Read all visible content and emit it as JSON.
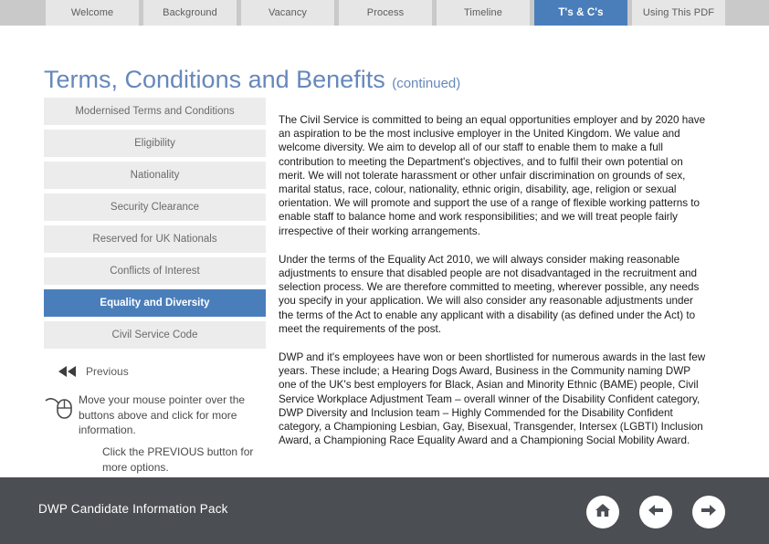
{
  "tabs": [
    {
      "label": "Welcome",
      "active": false
    },
    {
      "label": "Background",
      "active": false
    },
    {
      "label": "Vacancy",
      "active": false
    },
    {
      "label": "Process",
      "active": false
    },
    {
      "label": "Timeline",
      "active": false
    },
    {
      "label": "T's & C's",
      "active": true
    },
    {
      "label": "Using This PDF",
      "active": false
    }
  ],
  "title": {
    "main": "Terms, Conditions and Benefits ",
    "suffix": "(continued)"
  },
  "sidebar": {
    "items": [
      {
        "label": "Modernised Terms and Conditions",
        "active": false
      },
      {
        "label": "Eligibility",
        "active": false
      },
      {
        "label": "Nationality",
        "active": false
      },
      {
        "label": "Security Clearance",
        "active": false
      },
      {
        "label": "Reserved for UK Nationals",
        "active": false
      },
      {
        "label": "Conflicts of Interest",
        "active": false
      },
      {
        "label": "Equality and Diversity",
        "active": true
      },
      {
        "label": "Civil Service Code",
        "active": false
      }
    ]
  },
  "previous": {
    "label": "Previous",
    "icon": "double-chevron-left-icon"
  },
  "hints": {
    "mouse_icon": "computer-mouse-icon",
    "mouse_text": "Move your mouse pointer over the buttons above and click for more information.",
    "note_text": "Click the PREVIOUS button for more options."
  },
  "content": {
    "paragraphs": [
      "The Civil Service is committed to being an equal opportunities employer and by 2020 have an aspiration to be the most inclusive employer in the United Kingdom. We value and welcome diversity. We aim to develop all of our staff to enable them to make a full contribution to meeting the Department's objectives, and to fulfil their own potential on merit. We will not tolerate harassment or other unfair discrimination on grounds of sex, marital status, race, colour, nationality, ethnic origin, disability, age, religion or sexual orientation. We will promote and support the use of a range of flexible working patterns to enable staff to balance home and work responsibilities; and we will treat people fairly irrespective of their working arrangements.",
      "Under the terms of the Equality Act 2010, we will always consider making reasonable adjustments to ensure that disabled people are not disadvantaged in the recruitment and selection process. We are therefore committed to meeting, wherever possible, any needs you specify in your application. We will also consider any reasonable adjustments under the terms of the Act to enable any applicant with a disability (as defined under the Act) to meet the requirements of the post.",
      "DWP and it's employees have won or been shortlisted for numerous awards in the last few years. These include; a Hearing Dogs Award, Business in the Community naming DWP one of the UK's best employers for Black, Asian and Minority Ethnic (BAME) people, Civil Service Workplace Adjustment Team – overall winner of the Disability Confident category, DWP Diversity and Inclusion team – Highly Commended for the Disability Confident category, a Championing Lesbian, Gay, Bisexual, Transgender, Intersex (LGBTI) Inclusion Award, a Championing Race Equality Award and a Championing Social Mobility Award."
    ]
  },
  "footer": {
    "title": "DWP Candidate Information Pack",
    "nav": [
      {
        "icon": "home-icon",
        "name": "home-button"
      },
      {
        "icon": "arrow-left-icon",
        "name": "back-button"
      },
      {
        "icon": "arrow-right-icon",
        "name": "forward-button"
      }
    ]
  },
  "colors": {
    "accent_blue": "#4a7ebb",
    "title_blue": "#6688bb",
    "tabbar_gray": "#c9c9c9",
    "tab_gray": "#e6e6e6",
    "sidebar_gray": "#ececec",
    "footer_gray": "#4b4e53"
  }
}
